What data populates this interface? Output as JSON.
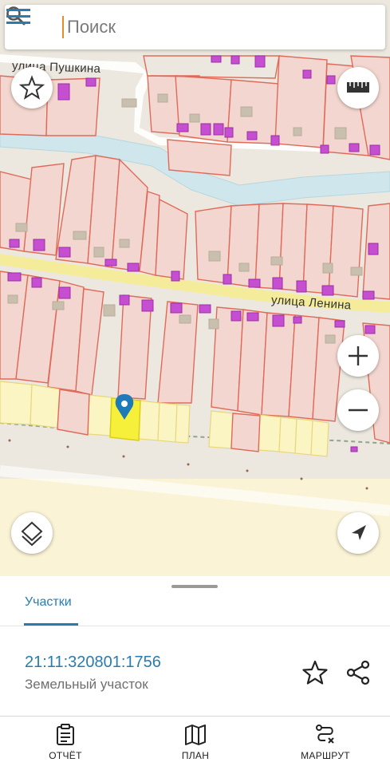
{
  "search": {
    "placeholder": "Поиск"
  },
  "map": {
    "street_labels": [
      "улица Пушкина",
      "улица Ленина"
    ],
    "controls": [
      "favorite-star",
      "ruler",
      "zoom-in",
      "zoom-out",
      "layers",
      "my-location"
    ]
  },
  "sheet": {
    "tab_label": "Участки",
    "cadastral_number": "21:11:320801:1756",
    "parcel_type": "Земельный участок"
  },
  "bottom_nav": [
    {
      "label": "ОТЧЁТ",
      "icon": "report-icon"
    },
    {
      "label": "ПЛАН",
      "icon": "map-icon"
    },
    {
      "label": "МАРШРУТ",
      "icon": "route-icon"
    }
  ],
  "colors": {
    "accent": "#2a7bb0",
    "parcel_outline": "#e06a5a",
    "building": "#c54fd0",
    "selected": "#f6f03a",
    "water": "#cfe7ec"
  }
}
